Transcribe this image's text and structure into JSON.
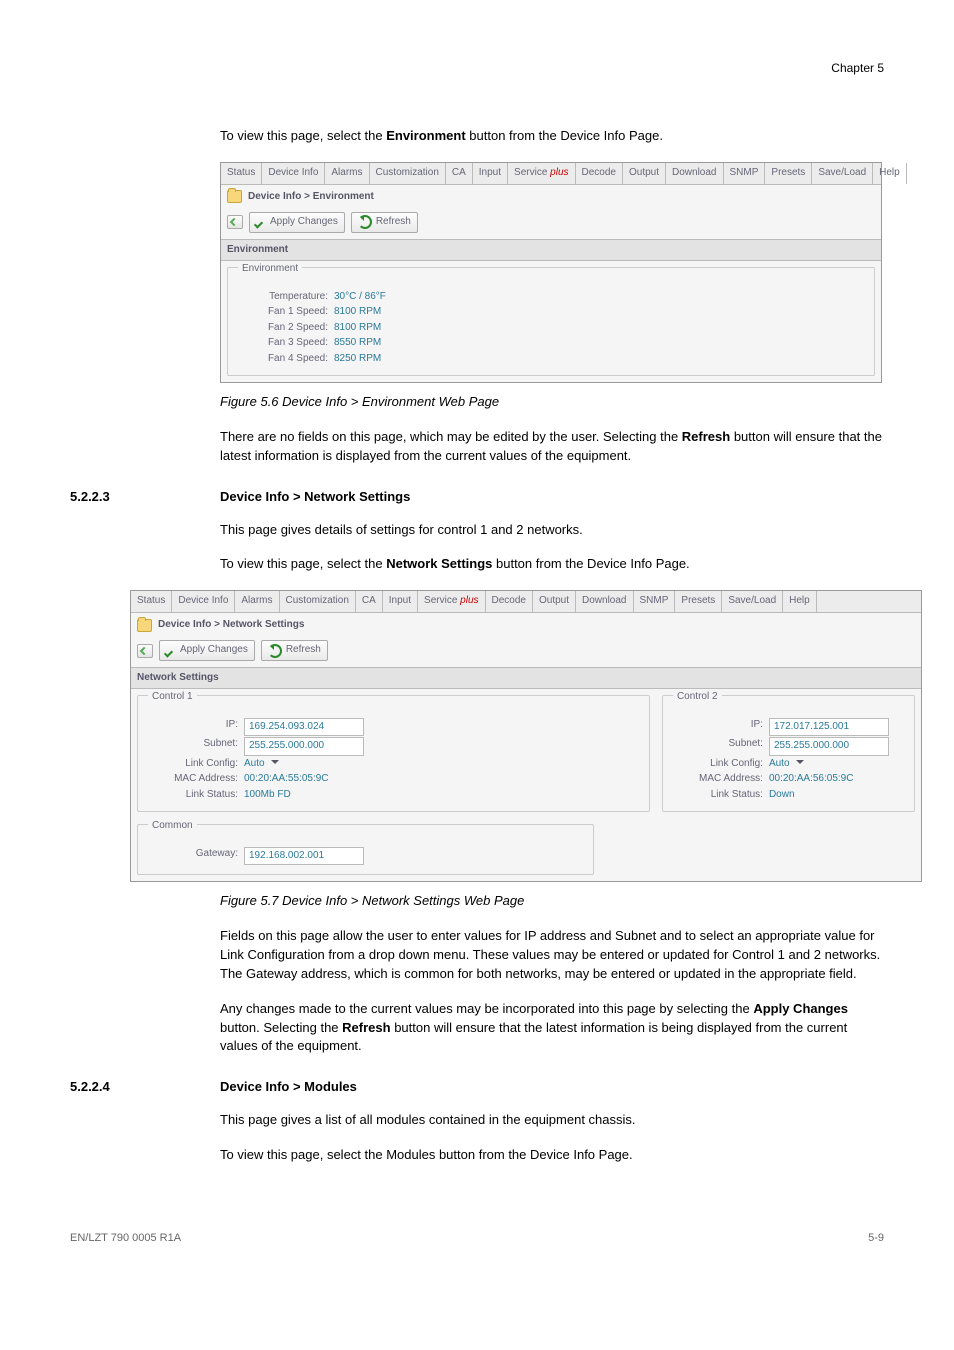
{
  "header": {
    "chapter": "Chapter 5"
  },
  "intro5_2_2_2": "To view this page, select the ",
  "intro5_2_2_2_bold": "Environment",
  "intro5_2_2_2_tail": " button from the Device Info Page.",
  "tabs": [
    "Status",
    "Device Info",
    "Alarms",
    "Customization",
    "CA",
    "Input",
    "Service ",
    "plus",
    "Decode",
    "Output",
    "Download",
    "SNMP",
    "Presets",
    "Save/Load",
    "Help"
  ],
  "screenshot1": {
    "breadcrumb": "Device Info > Environment",
    "applyChanges": "Apply Changes",
    "refresh": "Refresh",
    "panelTitle": "Environment",
    "legend": "Environment",
    "rows": [
      {
        "label": "Temperature:",
        "value": "30°C / 86°F"
      },
      {
        "label": "Fan 1 Speed:",
        "value": "8100 RPM"
      },
      {
        "label": "Fan 2 Speed:",
        "value": "8100 RPM"
      },
      {
        "label": "Fan 3 Speed:",
        "value": "8550 RPM"
      },
      {
        "label": "Fan 4 Speed:",
        "value": "8250 RPM"
      }
    ]
  },
  "fig56": "Figure 5.6   Device Info > Environment Web Page",
  "para_after56_a": "There are no fields on this page, which may be edited by the user. Selecting the ",
  "para_after56_b": "Refresh",
  "para_after56_c": " button will ensure that the latest information is displayed from the current values of the equipment.",
  "sec5223_num": "5.2.2.3",
  "sec5223_title": "Device Info > Network Settings",
  "sec5223_p1": "This page gives details of settings for control 1 and 2 networks.",
  "sec5223_p2a": "To view this page, select the ",
  "sec5223_p2b": "Network Settings",
  "sec5223_p2c": " button from the Device Info Page.",
  "screenshot2": {
    "breadcrumb": "Device Info > Network Settings",
    "applyChanges": "Apply Changes",
    "refresh": "Refresh",
    "panelTitle": "Network Settings",
    "legendC1": "Control 1",
    "legendC2": "Control 2",
    "legendCommon": "Common",
    "c1": {
      "ip": "169.254.093.024",
      "subnet": "255.255.000.000",
      "linkConfig": "Auto",
      "mac": "00:20:AA:55:05:9C",
      "linkStatus": "100Mb FD"
    },
    "c2": {
      "ip": "172.017.125.001",
      "subnet": "255.255.000.000",
      "linkConfig": "Auto",
      "mac": "00:20:AA:56:05:9C",
      "linkStatus": "Down"
    },
    "labels": {
      "ip": "IP:",
      "subnet": "Subnet:",
      "linkConfig": "Link Config:",
      "mac": "MAC Address:",
      "linkStatus": "Link Status:",
      "gateway": "Gateway:"
    },
    "gateway": "192.168.002.001"
  },
  "fig57": "Figure 5.7   Device Info > Network Settings Web Page",
  "para_after57": "Fields on this page allow the user to enter values for IP address and Subnet and to select an appropriate value for Link Configuration from a drop down menu. These values may be entered or updated for Control 1 and 2 networks. The Gateway address, which is common for both networks, may be entered or updated in the appropriate field.",
  "para_after57b_a": "Any changes made to the current values may be incorporated into this page by selecting the ",
  "para_after57b_b": "Apply Changes",
  "para_after57b_c": " button. Selecting the ",
  "para_after57b_d": "Refresh",
  "para_after57b_e": " button will ensure that the latest information is being displayed from the current values of the equipment.",
  "sec5224_num": "5.2.2.4",
  "sec5224_title": "Device Info > Modules",
  "sec5224_p1": "This page gives a list of all modules contained in the equipment chassis.",
  "sec5224_p2": "To view this page, select the Modules button from the Device Info Page.",
  "footer": {
    "left": "EN/LZT 790 0005 R1A",
    "right": "5-9"
  }
}
